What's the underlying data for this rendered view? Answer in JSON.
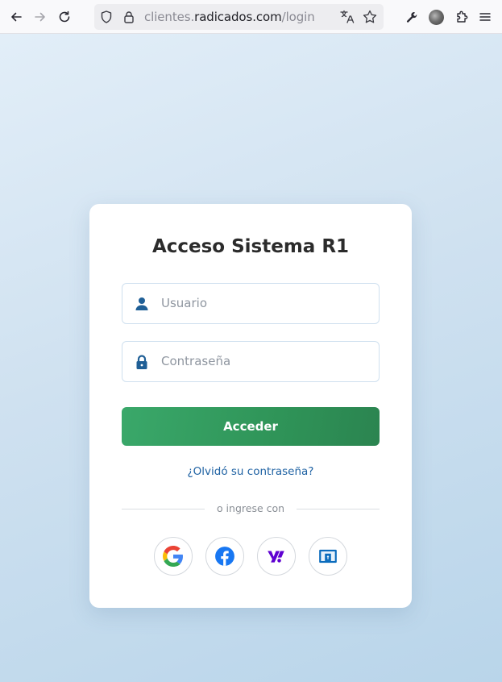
{
  "browser": {
    "url_prefix": "clientes.",
    "url_domain": "radicados.com",
    "url_path": "/login"
  },
  "login": {
    "title": "Acceso Sistema R1",
    "username_placeholder": "Usuario",
    "password_placeholder": "Contraseña",
    "submit_label": "Acceder",
    "forgot_label": "¿Olvidó su contraseña?",
    "divider_text": "o ingrese con",
    "social_providers": [
      "google",
      "facebook",
      "yahoo",
      "microsoft"
    ]
  },
  "colors": {
    "primary_green": "#2f9458",
    "link_blue": "#1f62a3",
    "icon_blue": "#1f5f96"
  }
}
